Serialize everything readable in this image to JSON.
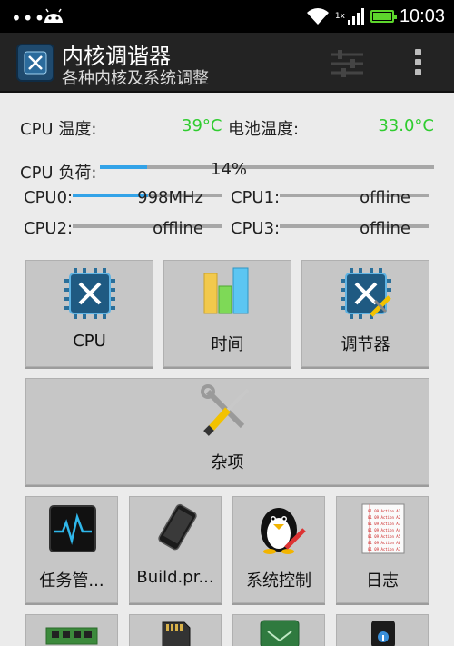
{
  "status_bar": {
    "dots": "•••",
    "time": "10:03",
    "network_label": "1x"
  },
  "action_bar": {
    "title": "内核调谐器",
    "subtitle": "各种内核及系统调整"
  },
  "info": {
    "cpu_temp_label": "CPU 温度:",
    "cpu_temp_value": "39°C",
    "battery_temp_label": "电池温度:",
    "battery_temp_value": "33.0°C",
    "cpu_load_label": "CPU 负荷:",
    "cpu_load_value": "14%",
    "cpu_load_fraction": 0.14,
    "cores": [
      {
        "label": "CPU0:",
        "value": "998MHz",
        "fraction": 0.5
      },
      {
        "label": "CPU1:",
        "value": "offline",
        "fraction": 0
      },
      {
        "label": "CPU2:",
        "value": "offline",
        "fraction": 0
      },
      {
        "label": "CPU3:",
        "value": "offline",
        "fraction": 0
      }
    ]
  },
  "tiles": {
    "row1": [
      {
        "label": "CPU",
        "icon": "chip-tools-icon"
      },
      {
        "label": "时间",
        "icon": "bar-chart-icon"
      },
      {
        "label": "调节器",
        "icon": "chip-wrench-icon"
      }
    ],
    "wide": {
      "label": "杂项",
      "icon": "wrench-screwdriver-icon"
    },
    "row3": [
      {
        "label": "任务管...",
        "icon": "heartbeat-monitor-icon"
      },
      {
        "label": "Build.pr...",
        "icon": "phone-icon"
      },
      {
        "label": "系统控制",
        "icon": "penguin-icon"
      },
      {
        "label": "日志",
        "icon": "log-sheet-icon"
      }
    ],
    "log_lines": [
      "01 09 Action A1",
      "01 09 Action A2",
      "01 09 Action A3",
      "01 09 Action A4",
      "01 09 Action A5",
      "01 09 Action A6",
      "01 09 Action A7"
    ]
  }
}
